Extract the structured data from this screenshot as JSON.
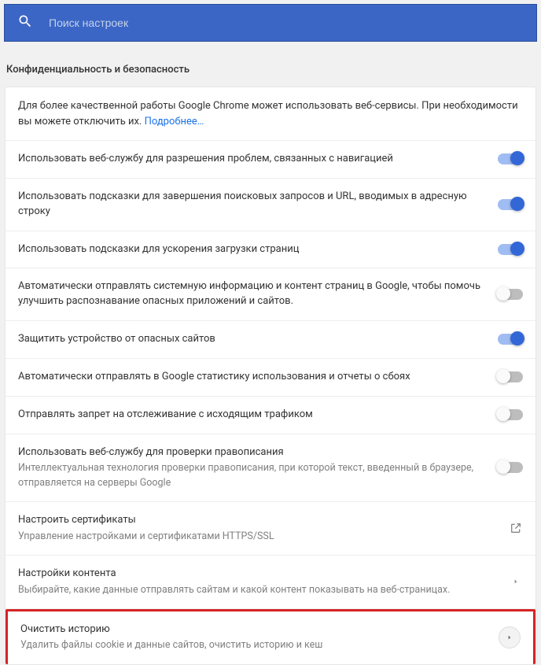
{
  "search": {
    "placeholder": "Поиск настроек"
  },
  "section_title": "Конфиденциальность и безопасность",
  "intro": {
    "text_before": "Для более качественной работы Google Chrome может использовать веб-сервисы. При необходимости вы можете отключить их. ",
    "link": "Подробнее…"
  },
  "rows": {
    "nav_err": {
      "label": "Использовать веб-службу для разрешения проблем, связанных с навигацией"
    },
    "suggest": {
      "label": "Использовать подсказки для завершения поисковых запросов и URL, вводимых в адресную строку"
    },
    "prefetch": {
      "label": "Использовать подсказки для ускорения загрузки страниц"
    },
    "auto_send": {
      "label": "Автоматически отправлять системную информацию и контент страниц в Google, чтобы помочь улучшить распознавание опасных приложений и сайтов."
    },
    "protect": {
      "label": "Защитить устройство от опасных сайтов"
    },
    "stats": {
      "label": "Автоматически отправлять в Google статистику использования и отчеты о сбоях"
    },
    "dnt": {
      "label": "Отправлять запрет на отслеживание с исходящим трафиком"
    },
    "spell": {
      "label": "Использовать веб-службу для проверки правописания",
      "sub": "Интеллектуальная технология проверки правописания, при которой текст, введенный в браузере, отправляется на серверы Google"
    },
    "certs": {
      "label": "Настроить сертификаты",
      "sub": "Управление настройками и сертификатами HTTPS/SSL"
    },
    "content": {
      "label": "Настройки контента",
      "sub": "Выбирайте, какие данные отправлять сайтам и какой контент показывать на веб-страницах."
    },
    "clear": {
      "label": "Очистить историю",
      "sub": "Удалить файлы cookie и данные сайтов, очистить историю и кеш"
    }
  }
}
